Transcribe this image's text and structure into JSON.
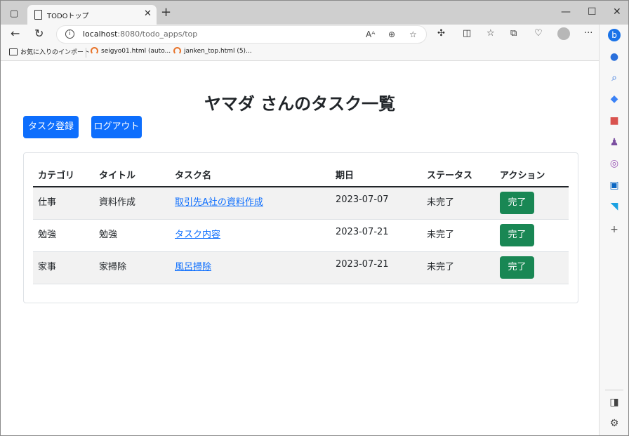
{
  "browser": {
    "tab_title": "TODOトップ",
    "url_host": "localhost",
    "url_rest": ":8080/todo_apps/top",
    "bookmarks": [
      {
        "label": "お気に入りのインポート"
      },
      {
        "label": "seigyo01.html (auto..."
      },
      {
        "label": "janken_top.html (5)..."
      }
    ]
  },
  "page": {
    "title": "ヤマダ さんのタスク一覧",
    "register_button": "タスク登録",
    "logout_button": "ログアウト",
    "table": {
      "headers": [
        "カテゴリ",
        "タイトル",
        "タスク名",
        "期日",
        "ステータス",
        "アクション"
      ],
      "rows": [
        {
          "category": "仕事",
          "title": "資料作成",
          "task": "取引先A社の資料作成",
          "due": "2023-07-07",
          "status": "未完了",
          "action": "完了"
        },
        {
          "category": "勉強",
          "title": "勉強",
          "task": "タスク内容",
          "due": "2023-07-21",
          "status": "未完了",
          "action": "完了"
        },
        {
          "category": "家事",
          "title": "家掃除",
          "task": "風呂掃除",
          "due": "2023-07-21",
          "status": "未完了",
          "action": "完了"
        }
      ]
    }
  },
  "colors": {
    "primary": "#0d6efd",
    "success": "#198754",
    "stripe": "#f2f2f2"
  }
}
